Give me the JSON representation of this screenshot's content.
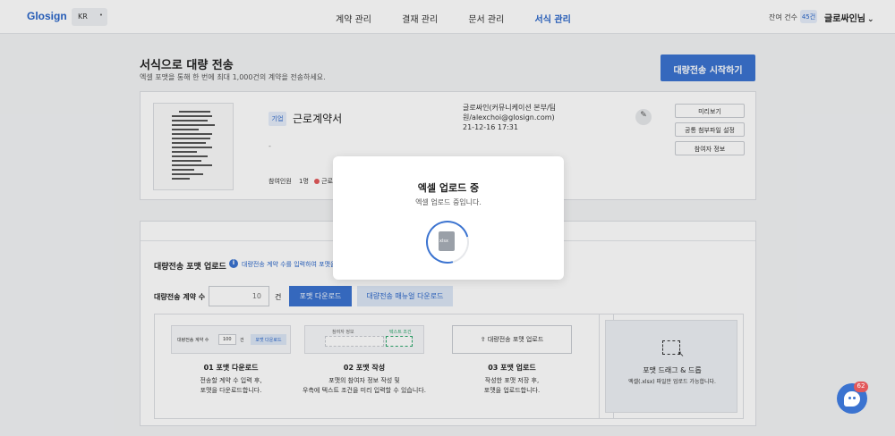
{
  "header": {
    "logo": "Glosign",
    "lang": "KR",
    "nav": [
      "계약 관리",
      "결재 관리",
      "문서 관리",
      "서식 관리"
    ],
    "active_nav": "서식 관리",
    "remain_label": "잔여 건수",
    "remain_count": "45건",
    "user": "글로싸인님"
  },
  "page": {
    "title": "서식으로 대량 전송",
    "subtitle": "엑셀 포맷을 통해 한 번에 최대 1,000건의 계약을 전송하세요.",
    "start_button": "대량전송 시작하기"
  },
  "template": {
    "tag": "기업",
    "name": "근로계약서",
    "dash": "-",
    "participants_label": "참여인원",
    "participants_count": "1명",
    "participant_name": "근로",
    "author": "글로싸인(커뮤니케이션 본부/팀원/alexchoi@glosign.com)",
    "date": "21-12-16 17:31",
    "buttons": [
      "미리보기",
      "공통 첨부파일 설정",
      "참여자 정보"
    ]
  },
  "bulk": {
    "format_title": "대량전송 포맷 업로드",
    "info_text": "대량전송 계약 수를 입력하여 포맷을",
    "count_label": "대량전송 계약 수",
    "count_value": "10",
    "count_unit": "건",
    "format_download": "포맷 다운로드",
    "manual_download": "대량전송 매뉴얼 다운로드",
    "mini_count_label": "대량전송 계약 수",
    "mini_count_value": "100",
    "mini_unit": "건",
    "mini_download": "포맷 다운로드",
    "mini_col1": "참여자 정보",
    "mini_col2": "텍스트 조건",
    "upload_label": "대량전송 포맷 업로드",
    "steps": [
      {
        "title": "01 포맷 다운로드",
        "desc1": "전송할 계약 수 입력 후,",
        "desc2": "포맷을 다운로드합니다."
      },
      {
        "title": "02 포맷 작성",
        "desc1": "포맷의 참여자 정보 작성 및",
        "desc2": "우측에 텍스트 조건을 미리 입력할 수 있습니다."
      },
      {
        "title": "03 포맷 업로드",
        "desc1": "작성한 포맷 저장 후,",
        "desc2": "포맷을 업로드합니다."
      }
    ],
    "drop_title": "포맷 드래그 & 드롭",
    "drop_desc": "엑셀(.xlsx) 파일만 업로드 가능합니다."
  },
  "modal": {
    "title": "엑셀 업로드 중",
    "desc": "엑셀 업로드 중입니다.",
    "file_ext": "xlsx"
  },
  "chat": {
    "badge": "62"
  },
  "colors": {
    "accent": "#3b73d0",
    "badge": "#e2595b"
  }
}
